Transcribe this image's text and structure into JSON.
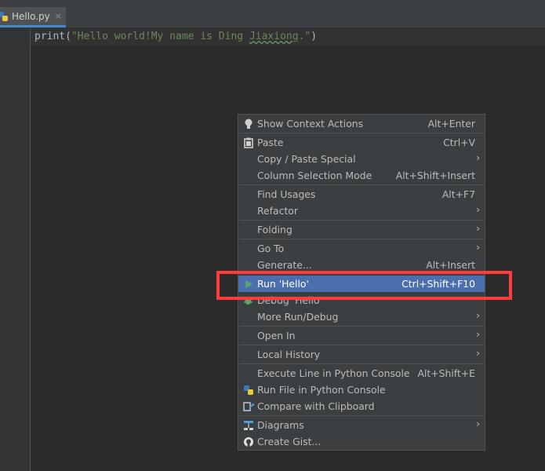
{
  "editor": {
    "tab_label": "Hello.py",
    "tab_close": "×",
    "code": {
      "func": "print",
      "open_paren": "(",
      "str_part1": "\"Hello world!My name is Ding ",
      "str_typo": "Jiaxiong",
      "str_part2": ".\"",
      "close_paren": ")"
    }
  },
  "context_menu": {
    "arrow_glyph": "›",
    "items": [
      {
        "label": "Show Context Actions",
        "shortcut": "Alt+Enter",
        "icon": "lightbulb-icon"
      },
      {
        "label": "Paste",
        "shortcut": "Ctrl+V",
        "icon": "clipboard-icon"
      },
      {
        "label": "Copy / Paste Special",
        "submenu": true
      },
      {
        "label": "Column Selection Mode",
        "shortcut": "Alt+Shift+Insert"
      },
      {
        "label": "Find Usages",
        "shortcut": "Alt+F7"
      },
      {
        "label": "Refactor",
        "submenu": true
      },
      {
        "label": "Folding",
        "submenu": true
      },
      {
        "label": "Go To",
        "submenu": true
      },
      {
        "label": "Generate...",
        "shortcut": "Alt+Insert"
      },
      {
        "label": "Run 'Hello'",
        "shortcut": "Ctrl+Shift+F10",
        "icon": "run-play-icon",
        "selected": true
      },
      {
        "label": "Debug 'Hello'",
        "icon": "debug-bug-icon"
      },
      {
        "label": "More Run/Debug",
        "submenu": true
      },
      {
        "label": "Open In",
        "submenu": true
      },
      {
        "label": "Local History",
        "submenu": true
      },
      {
        "label": "Execute Line in Python Console",
        "shortcut": "Alt+Shift+E"
      },
      {
        "label": "Run File in Python Console",
        "icon": "python-icon"
      },
      {
        "label": "Compare with Clipboard",
        "icon": "compare-icon"
      },
      {
        "label": "Diagrams",
        "submenu": true,
        "icon": "diagram-icon"
      },
      {
        "label": "Create Gist...",
        "icon": "github-icon"
      }
    ]
  },
  "colors": {
    "selection": "#4b6eaf",
    "highlight_box": "#ff3b3b"
  }
}
